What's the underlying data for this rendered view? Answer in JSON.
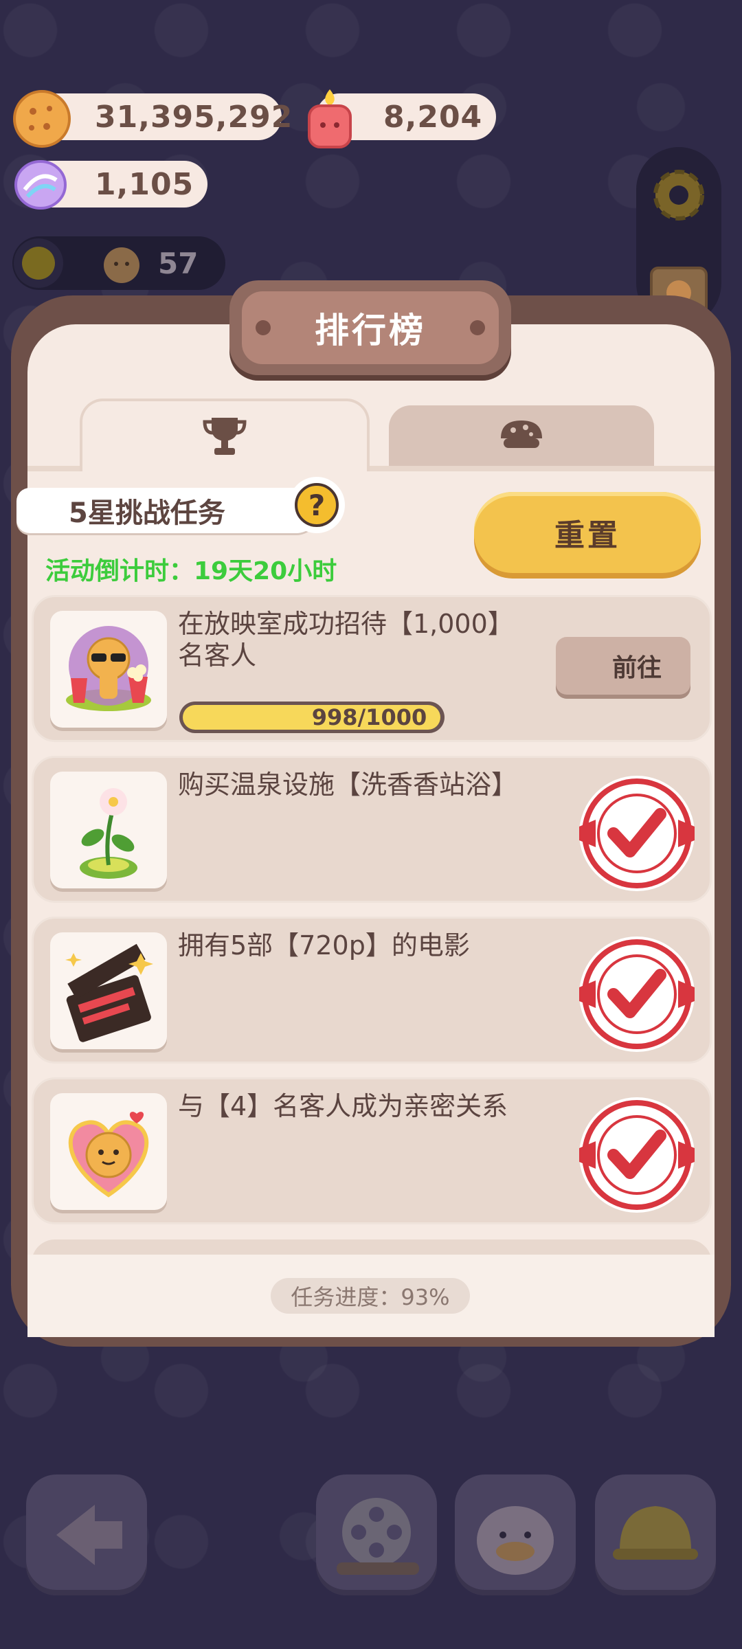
{
  "resources": {
    "cookies": "31,395,292",
    "candles": "8,204",
    "candies": "1,105",
    "visitors": "57"
  },
  "panel": {
    "title": "排行榜",
    "tabs": [
      {
        "icon": "trophy-icon",
        "active": true
      },
      {
        "icon": "cookie-icon",
        "active": false
      }
    ],
    "challenge_title": "5星挑战任务",
    "help_label": "?",
    "countdown": "活动倒计时：19天20小时",
    "reset_label": "重置",
    "tasks": [
      {
        "text": "在放映室成功招待【1,000】名客人",
        "progress_text": "998/1000",
        "progress": 0.998,
        "button": "前往",
        "completed": false
      },
      {
        "text": "购买温泉设施【洗香香站浴】",
        "completed": true
      },
      {
        "text": "拥有5部【720p】的电影",
        "completed": true
      },
      {
        "text": "与【4】名客人成为亲密关系",
        "completed": true
      }
    ],
    "overall_progress": "任务进度：93%"
  },
  "nav": [
    "back-arrow-icon",
    "film-reel-icon",
    "duck-character-icon",
    "helmet-icon"
  ],
  "colors": {
    "background": "#2f2a48",
    "panel_frame": "#6e5049",
    "panel_body": "#f6eae3",
    "countdown_green": "#3ccc3c",
    "reset_yellow": "#f3c34d",
    "stamp_red": "#d8363f"
  }
}
